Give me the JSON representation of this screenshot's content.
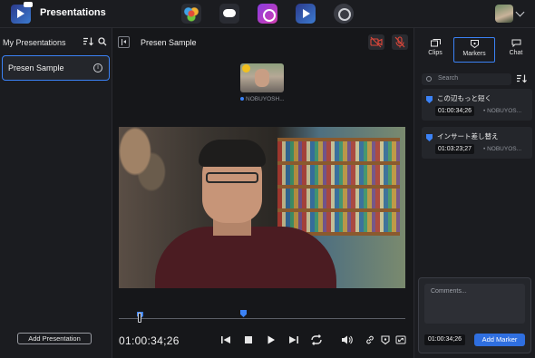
{
  "app": {
    "title": "Presentations"
  },
  "top_apps": [
    "davinci-resolve-icon",
    "cloud-icon",
    "camera-app-icon",
    "presentations-icon",
    "clock-icon"
  ],
  "sidebar": {
    "title": "My Presentations",
    "items": [
      {
        "label": "Presen Sample"
      }
    ],
    "add_button": "Add Presentation"
  },
  "viewer": {
    "title": "Presen Sample",
    "participant": "NOBUYOSH...",
    "timecode": "01:00:34;26"
  },
  "right_panel": {
    "tabs": [
      {
        "label": "Clips"
      },
      {
        "label": "Markers"
      },
      {
        "label": "Chat"
      }
    ],
    "search_placeholder": "Search",
    "markers": [
      {
        "title": "この辺もっと短く",
        "time": "01:00:34;26",
        "author": "NOBUYOS..."
      },
      {
        "title": "インサート差し替え",
        "time": "01:03:23;27",
        "author": "NOBUYOS..."
      }
    ],
    "comment_placeholder": "Comments...",
    "comment_time": "01:00:34;26",
    "add_marker": "Add Marker"
  },
  "colors": {
    "accent": "#3b82f6",
    "marker": "#3b82f6",
    "background": "#16171a"
  }
}
